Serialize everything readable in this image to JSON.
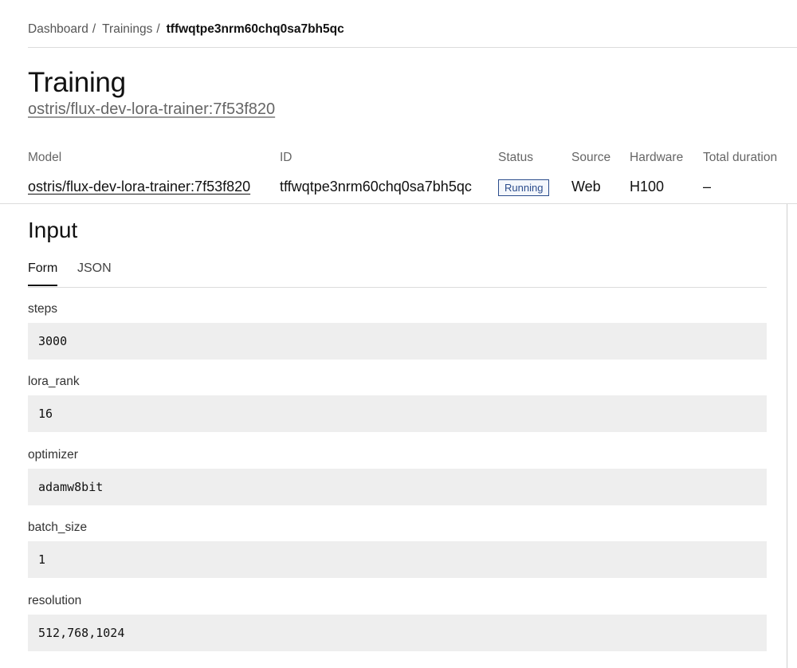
{
  "breadcrumb": {
    "dashboard": "Dashboard",
    "trainings": "Trainings",
    "separator": "/",
    "current": "tffwqtpe3nrm60chq0sa7bh5qc"
  },
  "page": {
    "title": "Training",
    "subtitle": "ostris/flux-dev-lora-trainer:7f53f820"
  },
  "meta": {
    "model": {
      "label": "Model",
      "value": "ostris/flux-dev-lora-trainer:7f53f820"
    },
    "id": {
      "label": "ID",
      "value": "tffwqtpe3nrm60chq0sa7bh5qc"
    },
    "status": {
      "label": "Status",
      "value": "Running",
      "color": "#2b4c8c"
    },
    "source": {
      "label": "Source",
      "value": "Web"
    },
    "hardware": {
      "label": "Hardware",
      "value": "H100"
    },
    "duration": {
      "label": "Total duration",
      "value": "–"
    }
  },
  "input": {
    "title": "Input",
    "tabs": [
      {
        "label": "Form",
        "active": true
      },
      {
        "label": "JSON",
        "active": false
      }
    ],
    "fields": [
      {
        "label": "steps",
        "value": "3000"
      },
      {
        "label": "lora_rank",
        "value": "16"
      },
      {
        "label": "optimizer",
        "value": "adamw8bit"
      },
      {
        "label": "batch_size",
        "value": "1"
      },
      {
        "label": "resolution",
        "value": "512,768,1024"
      }
    ]
  }
}
